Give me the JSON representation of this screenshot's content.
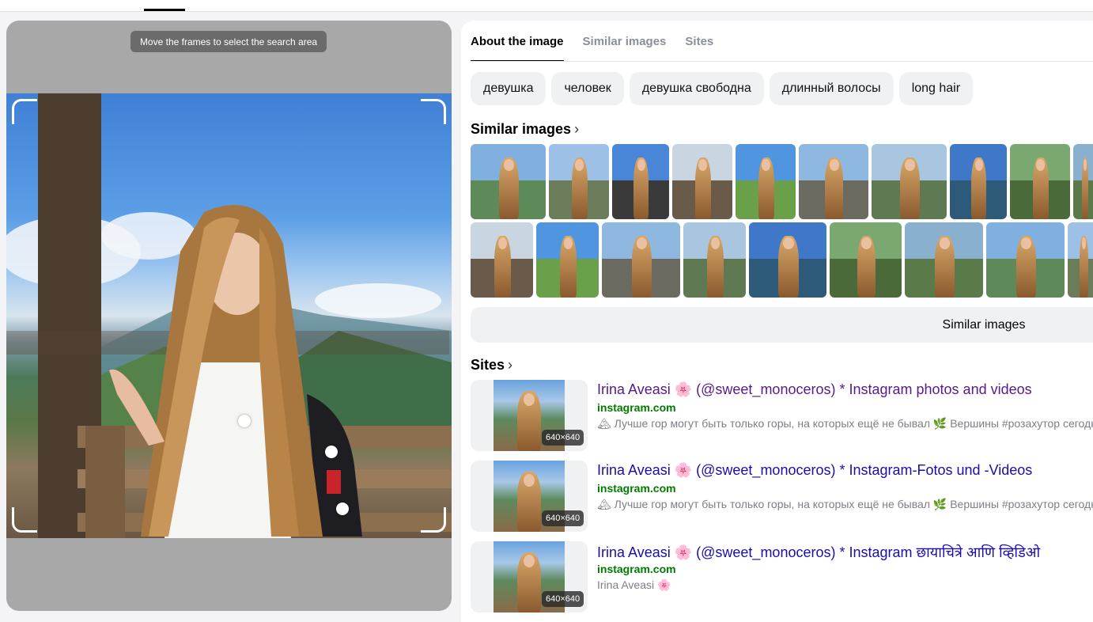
{
  "viewer": {
    "hint": "Move the frames to select the search area"
  },
  "tabs": [
    {
      "label": "About the image",
      "active": true
    },
    {
      "label": "Similar images",
      "active": false
    },
    {
      "label": "Sites",
      "active": false
    }
  ],
  "tags": [
    "девушка",
    "человек",
    "девушка свободна",
    "длинный волосы",
    "long hair"
  ],
  "similar": {
    "title": "Similar images",
    "button_label": "Similar images",
    "row1_widths": [
      95,
      76,
      72,
      76,
      76,
      88,
      95,
      72,
      76,
      30
    ],
    "row2_widths": [
      79,
      79,
      99,
      79,
      98,
      91,
      99,
      99,
      40
    ]
  },
  "sites": {
    "title": "Sites",
    "items": [
      {
        "title": "Irina Aveasi 🌸 (@sweet_monoceros) * Instagram photos and videos",
        "domain": "instagram.com",
        "snippet": "🏔 Лучше гор могут быть только горы, на которых ещё не бывал 🌿 Вершины #розахутор сегодня",
        "dims": "640×640",
        "visited": true
      },
      {
        "title": "Irina Aveasi 🌸 (@sweet_monoceros) * Instagram-Fotos und -Videos",
        "domain": "instagram.com",
        "snippet": "🏔 Лучше гор могут быть только горы, на которых ещё не бывал 🌿 Вершины #розахутор сегодня",
        "dims": "640×640",
        "visited": false
      },
      {
        "title": "Irina Aveasi 🌸 (@sweet_monoceros) * Instagram छायाचित्रे आणि व्हिडिओ",
        "domain": "instagram.com",
        "snippet": "Irina Aveasi 🌸",
        "dims": "640×640",
        "visited": false
      }
    ]
  },
  "colors": {
    "link": "#1a0dab",
    "visited_link": "#551a8b",
    "domain": "#007a00",
    "chip_bg": "#f0f1f3"
  }
}
